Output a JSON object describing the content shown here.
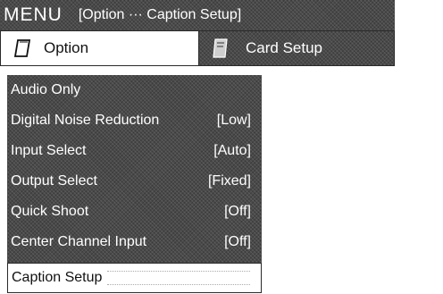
{
  "title_bar": {
    "menu": "MENU",
    "path": "[Option ··· Caption Setup]"
  },
  "tabs": [
    {
      "label": "Option",
      "icon": "option-card-icon",
      "active": true
    },
    {
      "label": "Card Setup",
      "icon": "card-setup-icon",
      "active": false
    }
  ],
  "menu": {
    "items": [
      {
        "label": "Audio Only",
        "value": ""
      },
      {
        "label": "Digital Noise Reduction",
        "value": "[Low]"
      },
      {
        "label": "Input Select",
        "value": "[Auto]"
      },
      {
        "label": "Output Select",
        "value": "[Fixed]"
      },
      {
        "label": "Quick Shoot",
        "value": "[Off]"
      },
      {
        "label": "Center Channel Input",
        "value": "[Off]"
      },
      {
        "label": "Caption Setup",
        "value": "",
        "selected": true
      }
    ]
  },
  "colors": {
    "panel_dark": "#4a4a4a",
    "text_light": "#ffffff",
    "text_dark": "#111111"
  }
}
